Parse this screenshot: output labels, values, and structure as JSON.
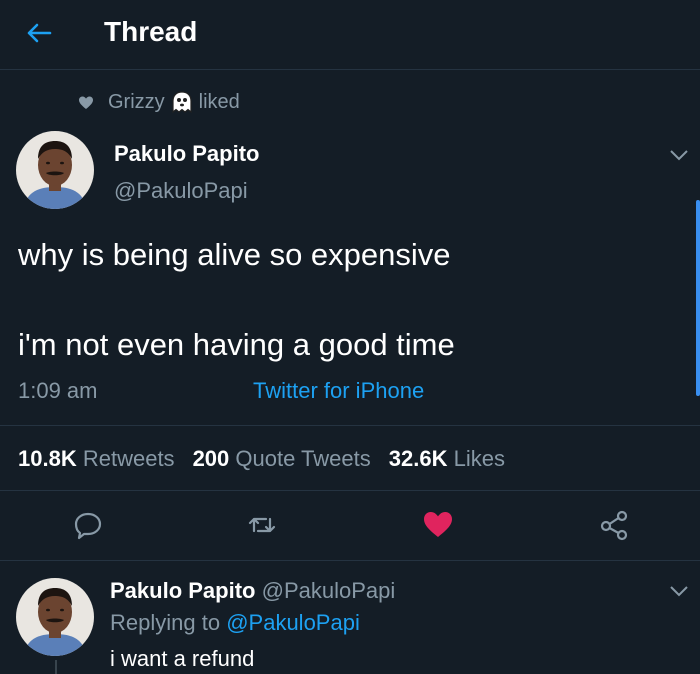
{
  "header": {
    "title": "Thread",
    "back_icon": "arrow-left-icon",
    "accent": "#1da1f2"
  },
  "social_context": {
    "user": "Grizzy",
    "emoji_icon": "ghost-icon",
    "action": "liked"
  },
  "tweet": {
    "author_name": "Pakulo Papito",
    "author_handle": "@PakuloPapi",
    "text_line1": "why is being alive so expensive",
    "text_line2": "i'm not even having a good time",
    "time": "1:09 am",
    "source": "Twitter for iPhone",
    "stats": {
      "retweets_count": "10.8K",
      "retweets_label": "Retweets",
      "quotes_count": "200",
      "quotes_label": "Quote Tweets",
      "likes_count": "32.6K",
      "likes_label": "Likes"
    },
    "liked": true,
    "like_color": "#e0245e"
  },
  "reply": {
    "author_name": "Pakulo Papito",
    "author_handle": "@PakuloPapi",
    "replying_to_label": "Replying to",
    "replying_to_handle": "@PakuloPapi",
    "text": "i want a refund"
  }
}
